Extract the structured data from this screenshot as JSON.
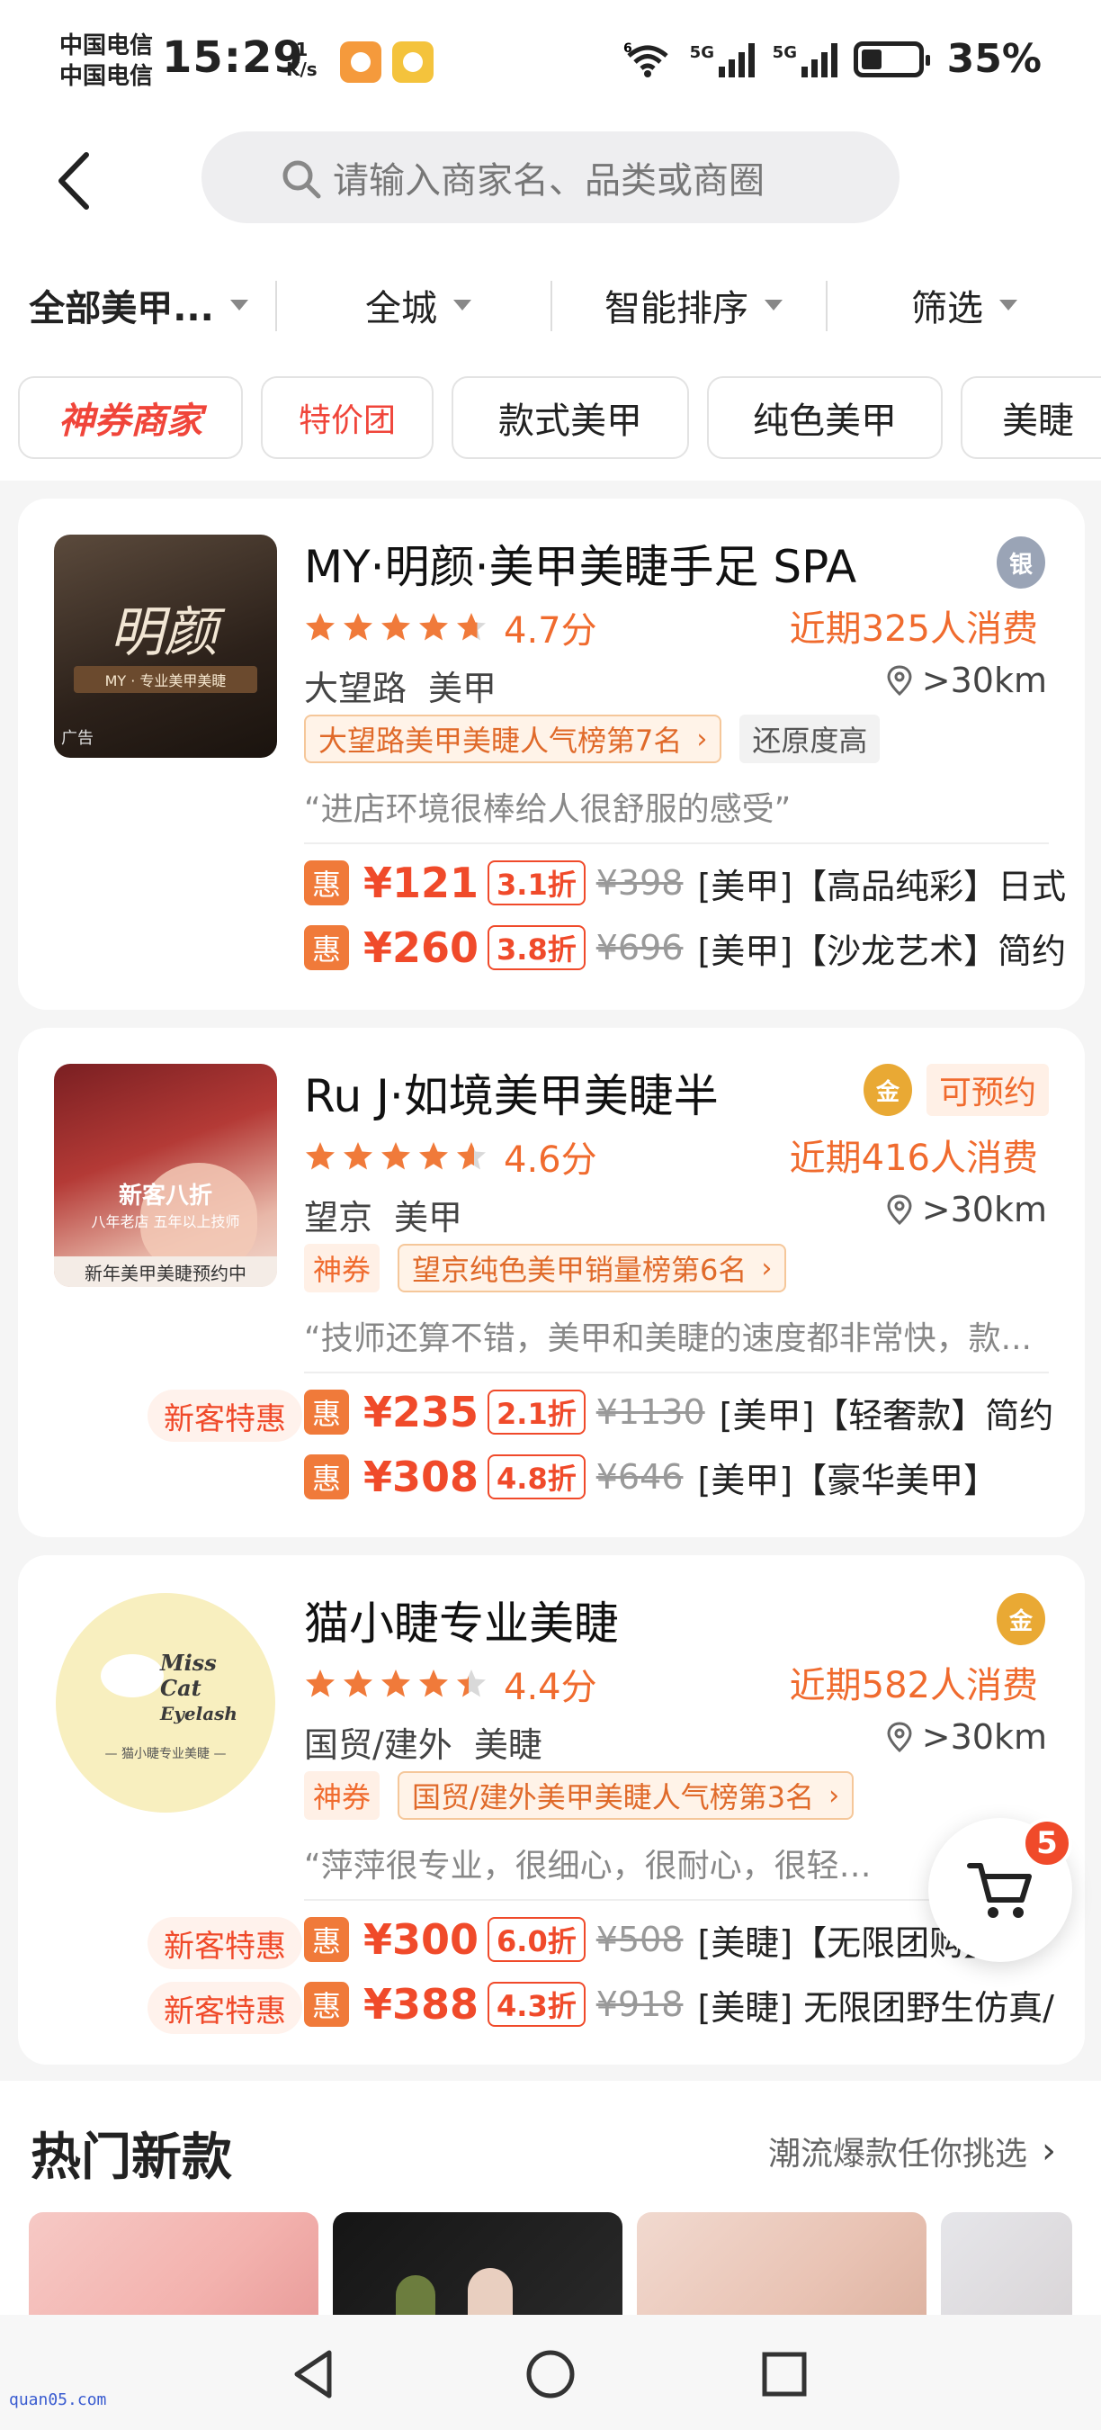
{
  "status_bar": {
    "carrier_1": "中国电信",
    "carrier_2": "中国电信",
    "time": "15:29",
    "net_speed_value": "1",
    "net_speed_unit": "K/s",
    "network_1": "5G",
    "network_2": "5G",
    "wifi_badge": "6",
    "battery": "35%"
  },
  "search": {
    "placeholder": "请输入商家名、品类或商圈"
  },
  "filters": {
    "category": "全部美甲...",
    "region": "全城",
    "sort": "智能排序",
    "filter": "筛选"
  },
  "chips": [
    {
      "label": "神券商家"
    },
    {
      "label": "特价团"
    },
    {
      "label": "款式美甲"
    },
    {
      "label": "纯色美甲"
    },
    {
      "label": "美睫"
    }
  ],
  "shops": [
    {
      "name": "MY·明颜·美甲美睫手足 SPA",
      "medal": "银",
      "rating_value": 4.7,
      "rating": "4.7分",
      "consumers": "近期325人消费",
      "area": "大望路",
      "category": "美甲",
      "distance": ">30km",
      "thumb_title": "明颜",
      "thumb_sub": "MY · 专业美甲美睫",
      "ad_label": "广告",
      "rank_tag": "大望路美甲美睫人气榜第7名",
      "extra_tag": "还原度高",
      "review": "“进店环境很棒给人很舒服的感受”",
      "deals": [
        {
          "hui": "惠",
          "price": "¥121",
          "discount": "3.1折",
          "original": "¥398",
          "title": "[美甲]【高品纯彩】日式"
        },
        {
          "hui": "惠",
          "price": "¥260",
          "discount": "3.8折",
          "original": "¥696",
          "title": "[美甲]【沙龙艺术】简约"
        }
      ]
    },
    {
      "name": "Ru J·如境美甲美睫半",
      "medal": "金",
      "bookable": "可预约",
      "rating_value": 4.6,
      "rating": "4.6分",
      "consumers": "近期416人消费",
      "area": "望京",
      "category": "美甲",
      "distance": ">30km",
      "thumb_promo_1": "新客八折",
      "thumb_promo_2": "八年老店 五年以上技师",
      "thumb_caption": "新年美甲美睫预约中",
      "coupon_tag": "神券",
      "rank_tag": "望京纯色美甲销量榜第6名",
      "review": "“技师还算不错，美甲和美睫的速度都非常快，款...",
      "new_customer": "新客特惠",
      "deals": [
        {
          "hui": "惠",
          "price": "¥235",
          "discount": "2.1折",
          "original": "¥1130",
          "title": "[美甲]【轻奢款】简约"
        },
        {
          "hui": "惠",
          "price": "¥308",
          "discount": "4.8折",
          "original": "¥646",
          "title": "[美甲]【豪华美甲】"
        }
      ]
    },
    {
      "name": "猫小睫专业美睫",
      "medal": "金",
      "rating_value": 4.4,
      "rating": "4.4分",
      "consumers": "近期582人消费",
      "area": "国贸/建外",
      "category": "美睫",
      "distance": ">30km",
      "thumb_logo_1": "Miss",
      "thumb_logo_2": "Cat",
      "thumb_logo_3": "Eyelash",
      "thumb_logo_sub": "— 猫小睫专业美睫 —",
      "coupon_tag": "神券",
      "rank_tag": "国贸/建外美甲美睫人气榜第3名",
      "review": "“萍萍很专业，很细心，很耐心，很轻柔”",
      "new_customer_1": "新客特惠",
      "new_customer_2": "新客特惠",
      "deals": [
        {
          "hui": "惠",
          "price": "¥300",
          "discount": "6.0折",
          "original": "¥508",
          "title": "[美睫]【无限团购】"
        },
        {
          "hui": "惠",
          "price": "¥388",
          "discount": "4.3折",
          "original": "¥918",
          "title": "[美睫] 无限团野生仿真/"
        }
      ]
    }
  ],
  "hot": {
    "title": "热门新款",
    "more": "潮流爆款任你挑选"
  },
  "cart": {
    "count": "5"
  },
  "watermark": "quan05.com",
  "colors": {
    "accent": "#f06b2e",
    "price_red": "#f04a2a",
    "star": "#f07a3a"
  }
}
